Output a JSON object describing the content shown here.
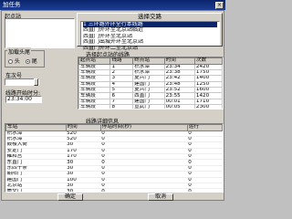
{
  "window": {
    "title": "加任务",
    "close_label": "×"
  },
  "selected": {
    "label": "起点站"
  },
  "direction_panel": {
    "title": "选择交路",
    "items": [
      "1 三环路外环全行本线路",
      "西直门外环至北京站临近",
      "西直门外环至北京站",
      "西直门出城外环至北京站",
      "西直门外环二至北京站"
    ],
    "selected_index": 0
  },
  "start_group": {
    "caption": "加载头尾",
    "options": [
      "头",
      "尾"
    ],
    "selected": "尾"
  },
  "car": {
    "label": "车次号"
  },
  "time": {
    "label": "线路开始时分:",
    "value": "23:34:00"
  },
  "checks": {
    "items": [
      "出库",
      "入库"
    ]
  },
  "station_grid": {
    "title": "选择起点站的线路",
    "headers": [
      "起点站",
      "线路",
      "终点站",
      "时间",
      "次数"
    ],
    "rows": [
      [
        "车辆段",
        "1",
        "积水潭",
        "23:34",
        "2420"
      ],
      [
        "车辆段",
        "2",
        "积水潭",
        "23:38",
        "1750"
      ],
      [
        "车辆段",
        "3",
        "复兴门",
        "23:42",
        "1400"
      ],
      [
        "车辆段",
        "4",
        "建国门",
        "23:48",
        "1250"
      ],
      [
        "车辆段",
        "5",
        "复兴门",
        "23:52",
        "1600"
      ],
      [
        "车辆段",
        "6",
        "西直门",
        "23:55",
        "1420"
      ],
      [
        "车辆段",
        "7",
        "建国门",
        "00:01",
        "1710"
      ],
      [
        "车辆段",
        "8",
        "宣武门",
        "00:05",
        "2300"
      ]
    ]
  },
  "detail": {
    "title": "线路详细信息",
    "headers": [
      "车站",
      "时间",
      "停站时间(秒)",
      "运行"
    ],
    "rows": [
      [
        "积水潭",
        "520",
        "0",
        "0"
      ],
      [
        "积水潭",
        "520",
        "0",
        "0"
      ],
      [
        "鼓楼大街",
        "30",
        "0",
        "0"
      ],
      [
        "安定门",
        "170",
        "0",
        "0"
      ],
      [
        "雍和宫",
        "170",
        "0",
        "0"
      ],
      [
        "东直门",
        "30",
        "0",
        "0"
      ],
      [
        "东四十条",
        "30",
        "0",
        "0"
      ],
      [
        "朝阳门",
        "30",
        "0",
        "0"
      ],
      [
        "建国门",
        "100",
        "0",
        "0"
      ],
      [
        "北京站",
        "30",
        "0",
        "0"
      ],
      [
        "崇文门",
        "30",
        "0",
        "0"
      ],
      [
        "前门",
        "40",
        "0",
        "0"
      ],
      [
        "和平门",
        "30",
        "0",
        "0"
      ],
      [
        "宣武门",
        "30",
        "0",
        "0"
      ]
    ]
  },
  "buttons": {
    "ok": "确定",
    "cancel": "取消"
  }
}
